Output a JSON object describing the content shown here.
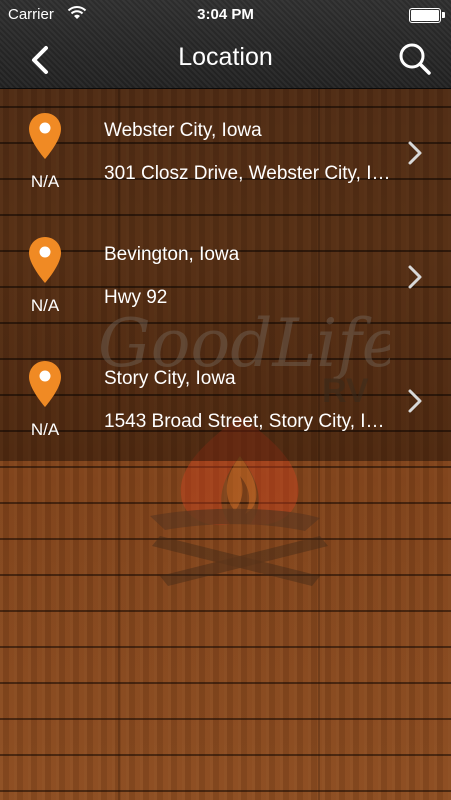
{
  "status_bar": {
    "carrier": "Carrier",
    "time": "3:04 PM"
  },
  "nav": {
    "title": "Location",
    "back_icon": "chevron-left-icon",
    "search_icon": "search-icon"
  },
  "locations": [
    {
      "distance": "N/A",
      "name": "Webster City, Iowa",
      "address": "301 Closz Drive, Webster City, I…"
    },
    {
      "distance": "N/A",
      "name": "Bevington, Iowa",
      "address": "Hwy 92"
    },
    {
      "distance": "N/A",
      "name": "Story City, Iowa",
      "address": "1543 Broad Street, Story City, I…"
    }
  ],
  "logo": {
    "brand": "GoodLife",
    "sub": "RV"
  },
  "colors": {
    "pin": "#f08a24",
    "nav_bg": "#2a2a2a",
    "wood": "#7a4320"
  }
}
